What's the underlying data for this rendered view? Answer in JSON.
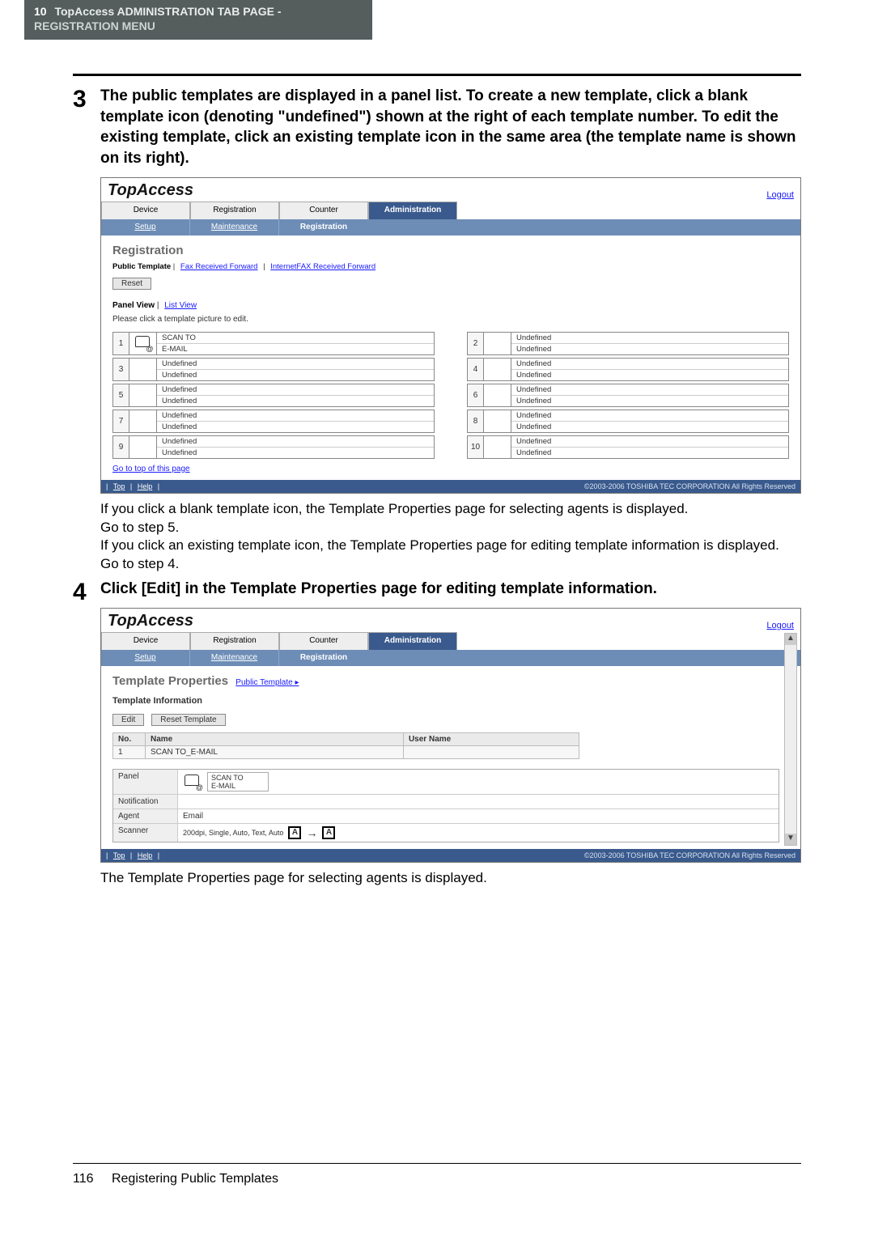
{
  "header": {
    "chapter_num": "10",
    "line1": "TopAccess ADMINISTRATION TAB PAGE -",
    "line2": "REGISTRATION MENU"
  },
  "step3": {
    "number": "3",
    "title": "The public templates are displayed in a panel list. To create a new template, click a blank template icon (denoting \"undefined\") shown at the right of each template number. To edit the existing template, click an existing template icon in the same area (the template name is shown on its right).",
    "after": [
      "If you click a blank template icon, the Template Properties page for selecting agents is displayed.",
      "Go to step 5.",
      "If you click an existing template icon, the Template Properties page for editing template information is displayed.",
      "Go to step 4."
    ],
    "shot": {
      "brand": "TopAccess",
      "logout": "Logout",
      "tabs": [
        "Device",
        "Registration",
        "Counter",
        "Administration"
      ],
      "active_tab_index": 3,
      "subtabs": [
        "Setup",
        "Maintenance",
        "Registration"
      ],
      "active_sub_index": 2,
      "heading": "Registration",
      "breadcrumb_bold": "Public Template",
      "breadcrumb_links": [
        "Fax Received Forward",
        "InternetFAX Received Forward"
      ],
      "reset": "Reset",
      "panel_view": "Panel View",
      "list_view_link": "List View",
      "instruction": "Please click a template picture to edit.",
      "left_rows": [
        {
          "n": "1",
          "a": "SCAN TO",
          "b": "E-MAIL",
          "icon": true
        },
        {
          "n": "3",
          "a": "Undefined",
          "b": "Undefined",
          "icon": false
        },
        {
          "n": "5",
          "a": "Undefined",
          "b": "Undefined",
          "icon": false
        },
        {
          "n": "7",
          "a": "Undefined",
          "b": "Undefined",
          "icon": false
        },
        {
          "n": "9",
          "a": "Undefined",
          "b": "Undefined",
          "icon": false
        }
      ],
      "right_rows": [
        {
          "n": "2",
          "a": "Undefined",
          "b": "Undefined"
        },
        {
          "n": "4",
          "a": "Undefined",
          "b": "Undefined"
        },
        {
          "n": "6",
          "a": "Undefined",
          "b": "Undefined"
        },
        {
          "n": "8",
          "a": "Undefined",
          "b": "Undefined"
        },
        {
          "n": "10",
          "a": "Undefined",
          "b": "Undefined"
        }
      ],
      "gototop": "Go to top of this page",
      "footer_links": [
        "Top",
        "Help"
      ],
      "copyright": "©2003-2006 TOSHIBA TEC CORPORATION All Rights Reserved"
    }
  },
  "step4": {
    "number": "4",
    "title": "Click [Edit] in the Template Properties page for editing template information.",
    "after": "The Template Properties page for selecting agents is displayed.",
    "shot": {
      "brand": "TopAccess",
      "logout": "Logout",
      "tabs": [
        "Device",
        "Registration",
        "Counter",
        "Administration"
      ],
      "active_tab_index": 3,
      "subtabs": [
        "Setup",
        "Maintenance",
        "Registration"
      ],
      "active_sub_index": 2,
      "heading": "Template Properties",
      "breadcrumb_link": "Public Template ▸",
      "section": "Template Information",
      "edit_btn": "Edit",
      "reset_btn": "Reset Template",
      "table_headers": [
        "No.",
        "Name",
        "User Name"
      ],
      "table_row": [
        "1",
        "SCAN TO_E-MAIL",
        ""
      ],
      "panel_label": "Panel",
      "panel_a": "SCAN TO",
      "panel_b": "E-MAIL",
      "notification_label": "Notification",
      "agent_label": "Agent",
      "agent_value": "Email",
      "scanner_label": "Scanner",
      "scanner_value": "200dpi, Single, Auto, Text, Auto",
      "footer_links": [
        "Top",
        "Help"
      ],
      "copyright": "©2003-2006 TOSHIBA TEC CORPORATION All Rights Reserved"
    }
  },
  "page_footer": {
    "number": "116",
    "title": "Registering Public Templates"
  }
}
